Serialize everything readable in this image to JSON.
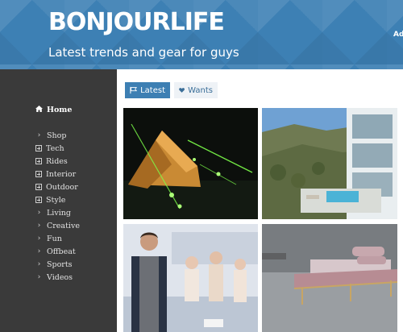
{
  "header": {
    "logo": "BONJOURLIFE",
    "tagline": "Latest trends and gear for guys",
    "link": "Adv"
  },
  "sidebar": {
    "home": {
      "label": "Home",
      "icon": "home-icon"
    },
    "items": [
      {
        "label": "Shop",
        "icon": "chevron-right-icon"
      },
      {
        "label": "Tech",
        "icon": "plus-square-icon"
      },
      {
        "label": "Rides",
        "icon": "plus-square-icon"
      },
      {
        "label": "Interior",
        "icon": "plus-square-icon"
      },
      {
        "label": "Outdoor",
        "icon": "plus-square-icon"
      },
      {
        "label": "Style",
        "icon": "plus-square-icon"
      },
      {
        "label": "Living",
        "icon": "chevron-right-icon"
      },
      {
        "label": "Creative",
        "icon": "chevron-right-icon"
      },
      {
        "label": "Fun",
        "icon": "chevron-right-icon"
      },
      {
        "label": "Offbeat",
        "icon": "chevron-right-icon"
      },
      {
        "label": "Sports",
        "icon": "chevron-right-icon"
      },
      {
        "label": "Videos",
        "icon": "chevron-right-icon"
      }
    ]
  },
  "filters": {
    "latest": {
      "label": "Latest",
      "icon": "flag-icon",
      "active": true
    },
    "wants": {
      "label": "Wants",
      "icon": "heart-icon",
      "active": false
    }
  },
  "colors": {
    "header_bg": "#3d80b4",
    "sidebar_bg": "#3a3a3a",
    "accent": "#3d7fb3"
  }
}
